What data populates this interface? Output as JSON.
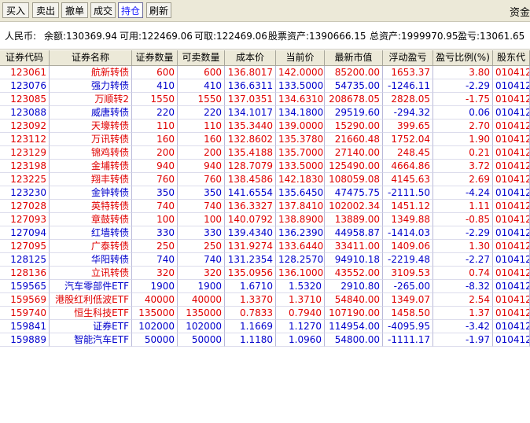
{
  "toolbar": {
    "buttons": [
      "买入",
      "卖出",
      "撤单",
      "成交",
      "持仓",
      "刷新"
    ],
    "right_label": "资金"
  },
  "summary": {
    "currency": "人民币:",
    "balance": "余额:130369.94",
    "available": "可用:122469.06",
    "withdrawable": "可取:122469.06",
    "stock_assets": "股票资产:1390666.15",
    "total_assets": "总资产:1999970.95",
    "pnl": "盈亏:13061.65"
  },
  "columns": [
    "证券代码",
    "证券名称",
    "证券数量",
    "可卖数量",
    "成本价",
    "当前价",
    "最新市值",
    "浮动盈亏",
    "盈亏比例(%)",
    "股东代"
  ],
  "rows": [
    {
      "code": "123061",
      "name": "航新转债",
      "qty": "600",
      "sell": "600",
      "cost": "136.8017",
      "price": "142.0000",
      "mv": "85200.00",
      "pl": "1653.37",
      "ratio": "3.80",
      "acct": "010412",
      "up": true
    },
    {
      "code": "123076",
      "name": "强力转债",
      "qty": "410",
      "sell": "410",
      "cost": "136.6311",
      "price": "133.5000",
      "mv": "54735.00",
      "pl": "-1246.11",
      "ratio": "-2.29",
      "acct": "010412",
      "up": false
    },
    {
      "code": "123085",
      "name": "万顺转2",
      "qty": "1550",
      "sell": "1550",
      "cost": "137.0351",
      "price": "134.6310",
      "mv": "208678.05",
      "pl": "2828.05",
      "ratio": "-1.75",
      "acct": "010412",
      "up": true
    },
    {
      "code": "123088",
      "name": "威唐转债",
      "qty": "220",
      "sell": "220",
      "cost": "134.1017",
      "price": "134.1800",
      "mv": "29519.60",
      "pl": "-294.32",
      "ratio": "0.06",
      "acct": "010412",
      "up": false
    },
    {
      "code": "123092",
      "name": "天壕转债",
      "qty": "110",
      "sell": "110",
      "cost": "135.3440",
      "price": "139.0000",
      "mv": "15290.00",
      "pl": "399.65",
      "ratio": "2.70",
      "acct": "010412",
      "up": true
    },
    {
      "code": "123112",
      "name": "万讯转债",
      "qty": "160",
      "sell": "160",
      "cost": "132.8602",
      "price": "135.3780",
      "mv": "21660.48",
      "pl": "1752.04",
      "ratio": "1.90",
      "acct": "010412",
      "up": true
    },
    {
      "code": "123129",
      "name": "锦鸡转债",
      "qty": "200",
      "sell": "200",
      "cost": "135.4188",
      "price": "135.7000",
      "mv": "27140.00",
      "pl": "248.45",
      "ratio": "0.21",
      "acct": "010412",
      "up": true
    },
    {
      "code": "123198",
      "name": "金埔转债",
      "qty": "940",
      "sell": "940",
      "cost": "128.7079",
      "price": "133.5000",
      "mv": "125490.00",
      "pl": "4664.86",
      "ratio": "3.72",
      "acct": "010412",
      "up": true
    },
    {
      "code": "123225",
      "name": "翔丰转债",
      "qty": "760",
      "sell": "760",
      "cost": "138.4586",
      "price": "142.1830",
      "mv": "108059.08",
      "pl": "4145.63",
      "ratio": "2.69",
      "acct": "010412",
      "up": true
    },
    {
      "code": "123230",
      "name": "金钟转债",
      "qty": "350",
      "sell": "350",
      "cost": "141.6554",
      "price": "135.6450",
      "mv": "47475.75",
      "pl": "-2111.50",
      "ratio": "-4.24",
      "acct": "010412",
      "up": false
    },
    {
      "code": "127028",
      "name": "英特转债",
      "qty": "740",
      "sell": "740",
      "cost": "136.3327",
      "price": "137.8410",
      "mv": "102002.34",
      "pl": "1451.12",
      "ratio": "1.11",
      "acct": "010412",
      "up": true
    },
    {
      "code": "127093",
      "name": "章鼓转债",
      "qty": "100",
      "sell": "100",
      "cost": "140.0792",
      "price": "138.8900",
      "mv": "13889.00",
      "pl": "1349.88",
      "ratio": "-0.85",
      "acct": "010412",
      "up": true
    },
    {
      "code": "127094",
      "name": "红墙转债",
      "qty": "330",
      "sell": "330",
      "cost": "139.4340",
      "price": "136.2390",
      "mv": "44958.87",
      "pl": "-1414.03",
      "ratio": "-2.29",
      "acct": "010412",
      "up": false
    },
    {
      "code": "127095",
      "name": "广泰转债",
      "qty": "250",
      "sell": "250",
      "cost": "131.9274",
      "price": "133.6440",
      "mv": "33411.00",
      "pl": "1409.06",
      "ratio": "1.30",
      "acct": "010412",
      "up": true
    },
    {
      "code": "128125",
      "name": "华阳转债",
      "qty": "740",
      "sell": "740",
      "cost": "131.2354",
      "price": "128.2570",
      "mv": "94910.18",
      "pl": "-2219.48",
      "ratio": "-2.27",
      "acct": "010412",
      "up": false
    },
    {
      "code": "128136",
      "name": "立讯转债",
      "qty": "320",
      "sell": "320",
      "cost": "135.0956",
      "price": "136.1000",
      "mv": "43552.00",
      "pl": "3109.53",
      "ratio": "0.74",
      "acct": "010412",
      "up": true
    },
    {
      "code": "159565",
      "name": "汽车零部件ETF",
      "qty": "1900",
      "sell": "1900",
      "cost": "1.6710",
      "price": "1.5320",
      "mv": "2910.80",
      "pl": "-265.00",
      "ratio": "-8.32",
      "acct": "010412",
      "up": false
    },
    {
      "code": "159569",
      "name": "港股红利低波ETF",
      "qty": "40000",
      "sell": "40000",
      "cost": "1.3370",
      "price": "1.3710",
      "mv": "54840.00",
      "pl": "1349.07",
      "ratio": "2.54",
      "acct": "010412",
      "up": true
    },
    {
      "code": "159740",
      "name": "恒生科技ETF",
      "qty": "135000",
      "sell": "135000",
      "cost": "0.7833",
      "price": "0.7940",
      "mv": "107190.00",
      "pl": "1458.50",
      "ratio": "1.37",
      "acct": "010412",
      "up": true
    },
    {
      "code": "159841",
      "name": "证券ETF",
      "qty": "102000",
      "sell": "102000",
      "cost": "1.1669",
      "price": "1.1270",
      "mv": "114954.00",
      "pl": "-4095.95",
      "ratio": "-3.42",
      "acct": "010412",
      "up": false
    },
    {
      "code": "159889",
      "name": "智能汽车ETF",
      "qty": "50000",
      "sell": "50000",
      "cost": "1.1180",
      "price": "1.0960",
      "mv": "54800.00",
      "pl": "-1111.17",
      "ratio": "-1.97",
      "acct": "010412",
      "up": false
    }
  ],
  "colors": {
    "up": "#e00000",
    "down": "#0000cc",
    "active_tab": "#1a1aff"
  }
}
